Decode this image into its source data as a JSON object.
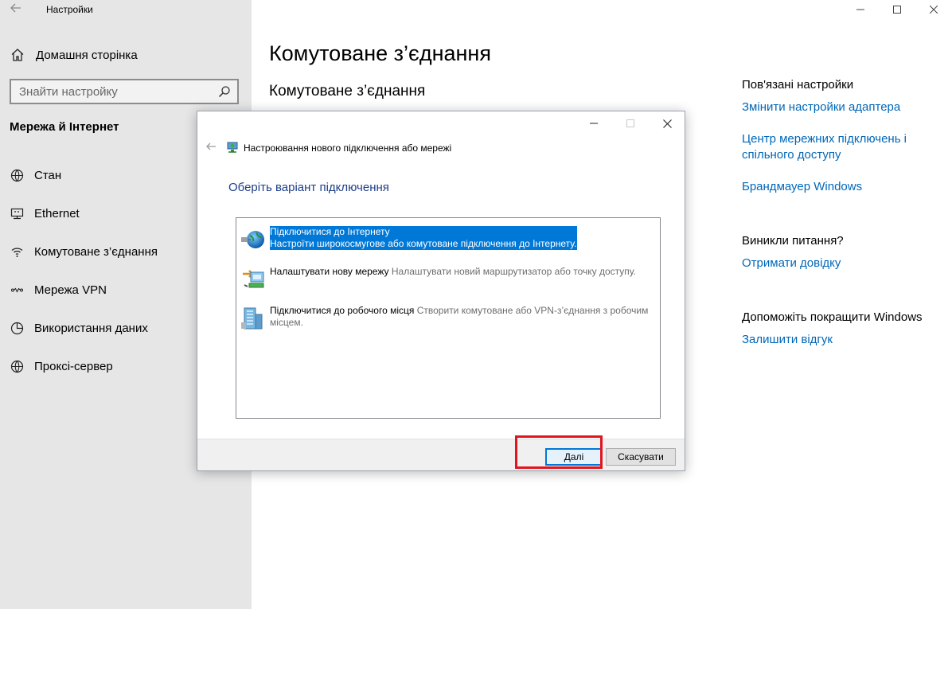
{
  "app": {
    "title": "Настройки",
    "back_icon": "back-arrow-icon"
  },
  "sidebar": {
    "home_label": "Домашня сторінка",
    "search_placeholder": "Знайти настройку",
    "section_title": "Мережа й Інтернет",
    "items": [
      {
        "label": "Стан",
        "icon": "globe-status-icon"
      },
      {
        "label": "Ethernet",
        "icon": "ethernet-icon"
      },
      {
        "label": "Комутоване з’єднання",
        "icon": "dialup-icon"
      },
      {
        "label": "Мережа VPN",
        "icon": "vpn-icon"
      },
      {
        "label": "Використання даних",
        "icon": "data-usage-icon"
      },
      {
        "label": "Проксі-сервер",
        "icon": "globe-icon"
      }
    ]
  },
  "main": {
    "title": "Комутоване з’єднання",
    "subtitle": "Комутоване з’єднання"
  },
  "related": {
    "heading": "Пов'язані настройки",
    "links": [
      "Змінити настройки адаптера",
      "Центр мережних підключень і спільного доступу",
      "Брандмауер Windows"
    ]
  },
  "questions": {
    "heading": "Виникли питання?",
    "link": "Отримати довідку"
  },
  "feedback": {
    "heading": "Допоможіть покращити Windows",
    "link": "Залишити відгук"
  },
  "dialog": {
    "title": "Настроювання нового підключення або мережі",
    "heading": "Оберіть варіант підключення",
    "options": [
      {
        "title": "Підключитися до Інтернету",
        "desc": "Настроїти широкосмугове або комутоване підключення до Інтернету.",
        "selected": true
      },
      {
        "title": "Налаштувати нову мережу",
        "desc": "Налаштувати новий маршрутизатор або точку доступу.",
        "selected": false
      },
      {
        "title": "Підключитися до робочого місця",
        "desc": "Створити комутоване або VPN-з’єднання з робочим місцем.",
        "selected": false
      }
    ],
    "next_label": "Далі",
    "cancel_label": "Скасувати"
  },
  "colors": {
    "accent": "#0078d7",
    "link": "#0067b8",
    "highlight": "#e0161f",
    "sidebar_bg": "#e6e6e6"
  }
}
